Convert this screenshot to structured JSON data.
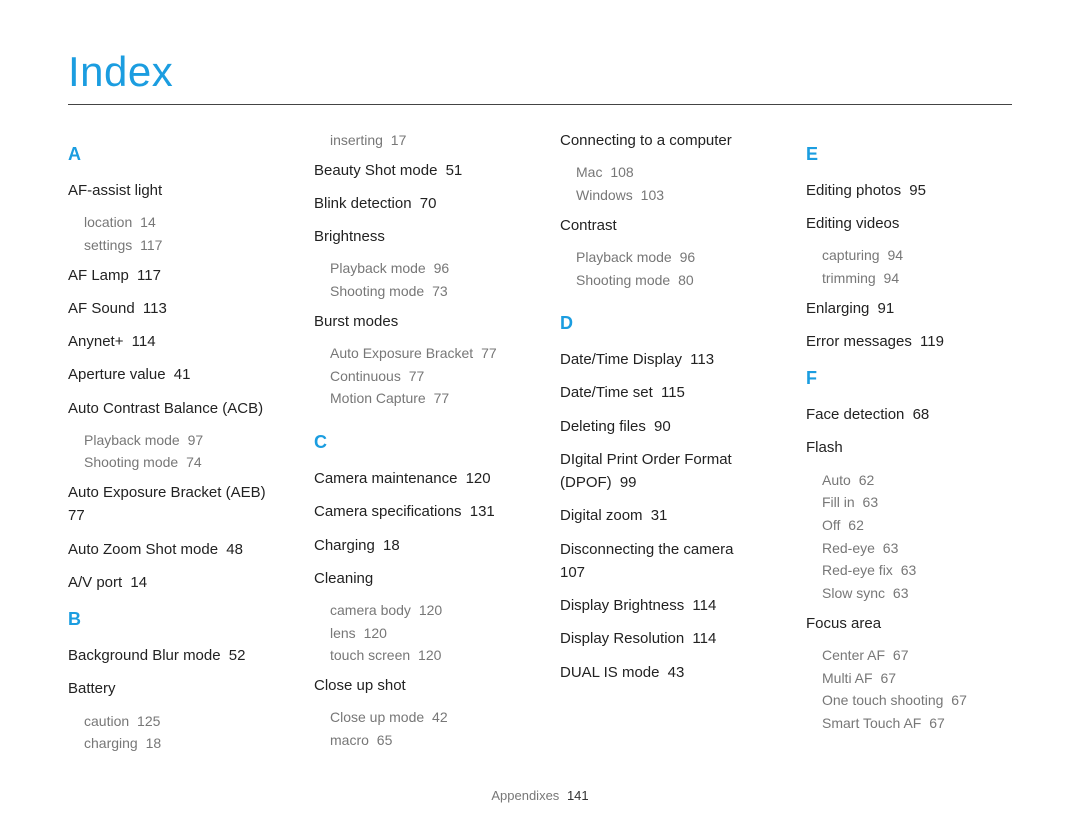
{
  "title": "Index",
  "footer": {
    "section": "Appendixes",
    "page": "141"
  },
  "columns": [
    [
      {
        "type": "letter",
        "text": "A"
      },
      {
        "type": "entry",
        "term": "AF-assist light",
        "subs": [
          {
            "t": "location",
            "p": "14"
          },
          {
            "t": "settings",
            "p": "117"
          }
        ]
      },
      {
        "type": "entry",
        "term": "AF Lamp",
        "page": "117"
      },
      {
        "type": "entry",
        "term": "AF Sound",
        "page": "113"
      },
      {
        "type": "entry",
        "term": "Anynet+",
        "page": "114"
      },
      {
        "type": "entry",
        "term": "Aperture value",
        "page": "41"
      },
      {
        "type": "entry",
        "term": "Auto Contrast Balance (ACB)",
        "subs": [
          {
            "t": "Playback mode",
            "p": "97"
          },
          {
            "t": "Shooting mode",
            "p": "74"
          }
        ]
      },
      {
        "type": "entry",
        "term": "Auto Exposure Bracket (AEB)",
        "page": "77"
      },
      {
        "type": "entry",
        "term": "Auto Zoom Shot mode",
        "page": "48"
      },
      {
        "type": "entry",
        "term": "A/V port",
        "page": "14"
      },
      {
        "type": "letter",
        "text": "B"
      },
      {
        "type": "entry",
        "term": "Background Blur mode",
        "page": "52"
      },
      {
        "type": "entry",
        "term": "Battery",
        "subs": [
          {
            "t": "caution",
            "p": "125"
          },
          {
            "t": "charging",
            "p": "18"
          }
        ]
      }
    ],
    [
      {
        "type": "sub-only",
        "subs": [
          {
            "t": "inserting",
            "p": "17"
          }
        ]
      },
      {
        "type": "entry",
        "term": "Beauty Shot mode",
        "page": "51"
      },
      {
        "type": "entry",
        "term": "Blink detection",
        "page": "70"
      },
      {
        "type": "entry",
        "term": "Brightness",
        "subs": [
          {
            "t": "Playback mode",
            "p": "96"
          },
          {
            "t": "Shooting mode",
            "p": "73"
          }
        ]
      },
      {
        "type": "entry",
        "term": "Burst modes",
        "subs": [
          {
            "t": "Auto Exposure Bracket",
            "p": "77"
          },
          {
            "t": "Continuous",
            "p": "77"
          },
          {
            "t": "Motion Capture",
            "p": "77"
          }
        ]
      },
      {
        "type": "letter",
        "text": "C"
      },
      {
        "type": "entry",
        "term": "Camera maintenance",
        "page": "120"
      },
      {
        "type": "entry",
        "term": "Camera specifications",
        "page": "131"
      },
      {
        "type": "entry",
        "term": "Charging",
        "page": "18"
      },
      {
        "type": "entry",
        "term": "Cleaning",
        "subs": [
          {
            "t": "camera body",
            "p": "120"
          },
          {
            "t": "lens",
            "p": "120"
          },
          {
            "t": "touch screen",
            "p": "120"
          }
        ]
      },
      {
        "type": "entry",
        "term": "Close up shot",
        "subs": [
          {
            "t": "Close up mode",
            "p": "42"
          },
          {
            "t": "macro",
            "p": "65"
          }
        ]
      }
    ],
    [
      {
        "type": "entry",
        "term": "Connecting to a computer",
        "subs": [
          {
            "t": "Mac",
            "p": "108"
          },
          {
            "t": "Windows",
            "p": "103"
          }
        ]
      },
      {
        "type": "entry",
        "term": "Contrast",
        "subs": [
          {
            "t": "Playback mode",
            "p": "96"
          },
          {
            "t": "Shooting mode",
            "p": "80"
          }
        ]
      },
      {
        "type": "letter",
        "text": "D"
      },
      {
        "type": "entry",
        "term": "Date/Time Display",
        "page": "113"
      },
      {
        "type": "entry",
        "term": "Date/Time set",
        "page": "115"
      },
      {
        "type": "entry",
        "term": "Deleting files",
        "page": "90"
      },
      {
        "type": "entry",
        "term": "DIgital Print Order Format (DPOF)",
        "page": "99"
      },
      {
        "type": "entry",
        "term": "Digital zoom",
        "page": "31"
      },
      {
        "type": "entry",
        "term": "Disconnecting the camera",
        "page": "107"
      },
      {
        "type": "entry",
        "term": "Display Brightness",
        "page": "114"
      },
      {
        "type": "entry",
        "term": "Display Resolution",
        "page": "114"
      },
      {
        "type": "entry",
        "term": "DUAL IS mode",
        "page": "43"
      }
    ],
    [
      {
        "type": "letter",
        "text": "E"
      },
      {
        "type": "entry",
        "term": "Editing photos",
        "page": "95"
      },
      {
        "type": "entry",
        "term": "Editing videos",
        "subs": [
          {
            "t": "capturing",
            "p": "94"
          },
          {
            "t": "trimming",
            "p": "94"
          }
        ]
      },
      {
        "type": "entry",
        "term": "Enlarging",
        "page": "91"
      },
      {
        "type": "entry",
        "term": "Error messages",
        "page": "119"
      },
      {
        "type": "letter",
        "text": "F"
      },
      {
        "type": "entry",
        "term": "Face detection",
        "page": "68"
      },
      {
        "type": "entry",
        "term": "Flash",
        "subs": [
          {
            "t": "Auto",
            "p": "62"
          },
          {
            "t": "Fill in",
            "p": "63"
          },
          {
            "t": "Off",
            "p": "62"
          },
          {
            "t": "Red-eye",
            "p": "63"
          },
          {
            "t": "Red-eye fix",
            "p": "63"
          },
          {
            "t": "Slow sync",
            "p": "63"
          }
        ]
      },
      {
        "type": "entry",
        "term": "Focus area",
        "subs": [
          {
            "t": "Center AF",
            "p": "67"
          },
          {
            "t": "Multi AF",
            "p": "67"
          },
          {
            "t": "One touch shooting",
            "p": "67"
          },
          {
            "t": "Smart Touch AF",
            "p": "67"
          }
        ]
      }
    ]
  ]
}
